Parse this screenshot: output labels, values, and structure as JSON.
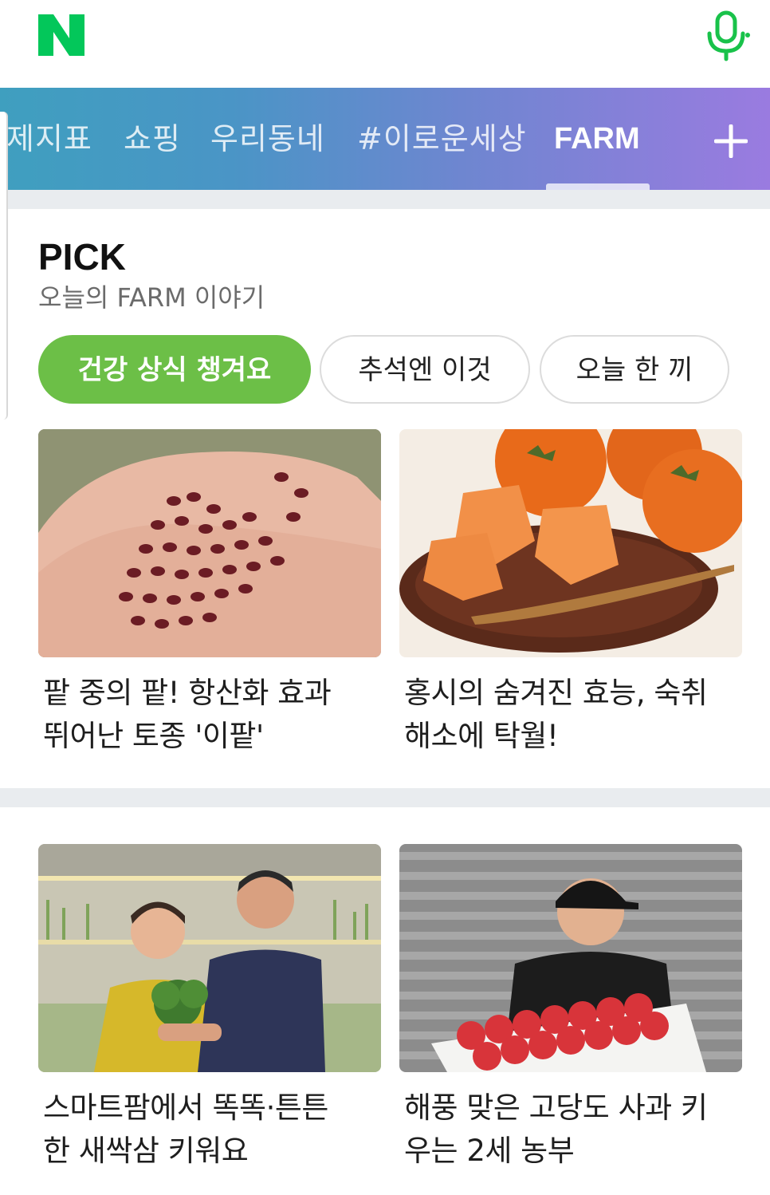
{
  "header": {
    "logo_label": "N"
  },
  "tabs": [
    {
      "label": "제지표"
    },
    {
      "label": "쇼핑"
    },
    {
      "label": "우리동네"
    },
    {
      "label": "#이로운세상"
    },
    {
      "label": "FARM"
    }
  ],
  "pick": {
    "title": "PICK",
    "subtitle": "오늘의 FARM 이야기",
    "chips": [
      "건강 상식 챙겨요",
      "추석엔 이것",
      "오늘 한 끼"
    ]
  },
  "cards": [
    {
      "title_line1": "팥 중의 팥! 항산화 효과",
      "title_line2": "뛰어난 토종 '이팥'",
      "image": "adzuki-beans-in-hand"
    },
    {
      "title_line1": "홍시의 숨겨진 효능, 숙취",
      "title_line2": "해소에 탁월!",
      "image": "persimmons-on-plate"
    },
    {
      "title_line1": "스마트팜에서 똑똑·튼튼",
      "title_line2": "한 새싹삼 키워요",
      "image": "couple-holding-ginseng-sprouts"
    },
    {
      "title_line1": "해풍 맞은 고당도 사과 키",
      "title_line2": "우는 2세 농부",
      "image": "young-farmer-with-apple-box"
    }
  ],
  "colors": {
    "brand_green": "#03c75a",
    "chip_active": "#6cbf47"
  }
}
